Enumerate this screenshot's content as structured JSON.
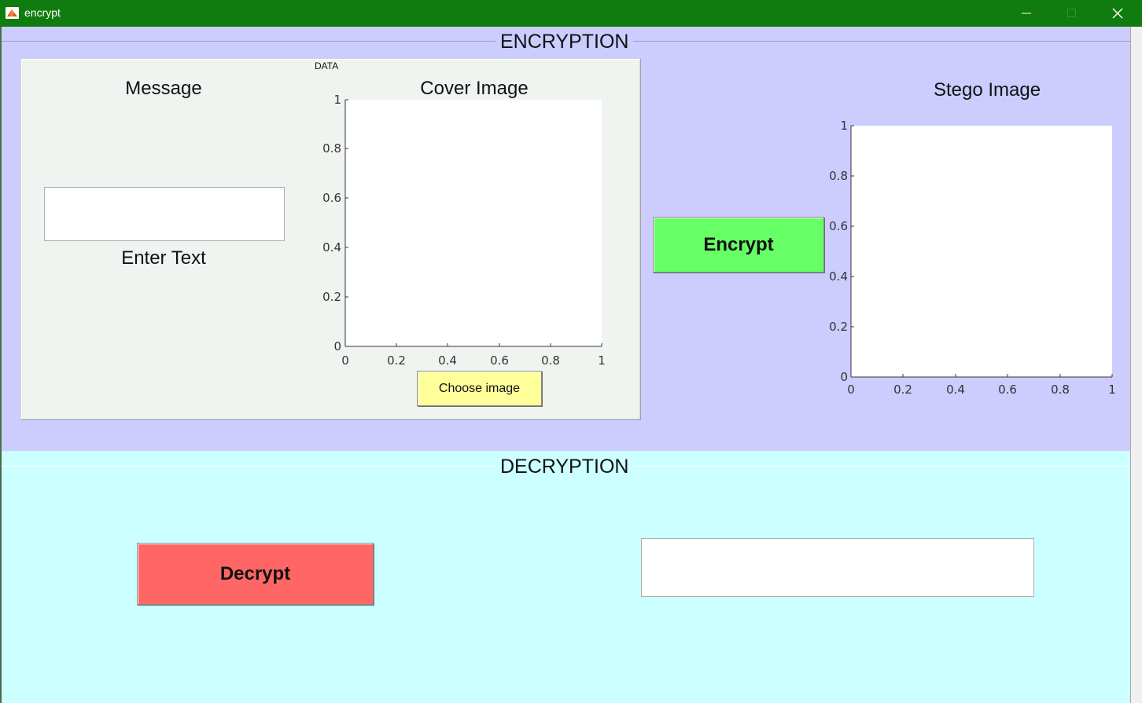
{
  "window": {
    "title": "encrypt",
    "minimize_icon": "minimize-icon",
    "maximize_icon": "maximize-icon",
    "close_icon": "close-icon"
  },
  "encryption": {
    "panel_title": "ENCRYPTION",
    "background": "#ccccff",
    "data_group_label": "DATA",
    "message_heading": "Message",
    "message_input_value": "",
    "enter_text_label": "Enter Text",
    "cover_image_title": "Cover Image",
    "choose_image_button": "Choose image",
    "encrypt_button": "Encrypt",
    "stego_image_title": "Stego Image",
    "colors": {
      "encrypt_button": "#66ff66",
      "choose_image_button": "#ffff99"
    }
  },
  "decryption": {
    "panel_title": "DECRYPTION",
    "background": "#ccffff",
    "decrypt_button": "Decrypt",
    "output_value": "",
    "colors": {
      "decrypt_button": "#ff6666"
    }
  },
  "axes_ticks": [
    "0",
    "0.2",
    "0.4",
    "0.6",
    "0.8",
    "1"
  ]
}
